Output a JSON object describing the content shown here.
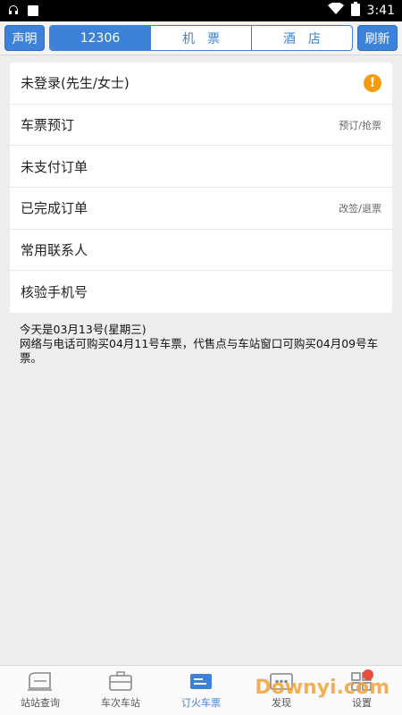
{
  "status": {
    "time": "3:41"
  },
  "topbar": {
    "left_button": "声明",
    "right_button": "刷新",
    "segments": [
      "12306",
      "机　票",
      "酒　店"
    ]
  },
  "menu": {
    "login": "未登录(先生/女士)",
    "ticket_booking": {
      "label": "车票预订",
      "hint": "预订/抢票"
    },
    "unpaid": "未支付订单",
    "completed": {
      "label": "已完成订单",
      "hint": "改签/退票"
    },
    "contacts": "常用联系人",
    "verify_phone": "核验手机号"
  },
  "notice": {
    "line1": "今天是03月13号(星期三)",
    "line2": "网络与电话可购买04月11号车票，代售点与车站窗口可购买04月09号车票。"
  },
  "tabs": [
    "站站查询",
    "车次车站",
    "订火车票",
    "发现",
    "设置"
  ],
  "watermark": "Downyi.com",
  "colors": {
    "accent": "#3b82d8",
    "warning": "#f39c12"
  }
}
